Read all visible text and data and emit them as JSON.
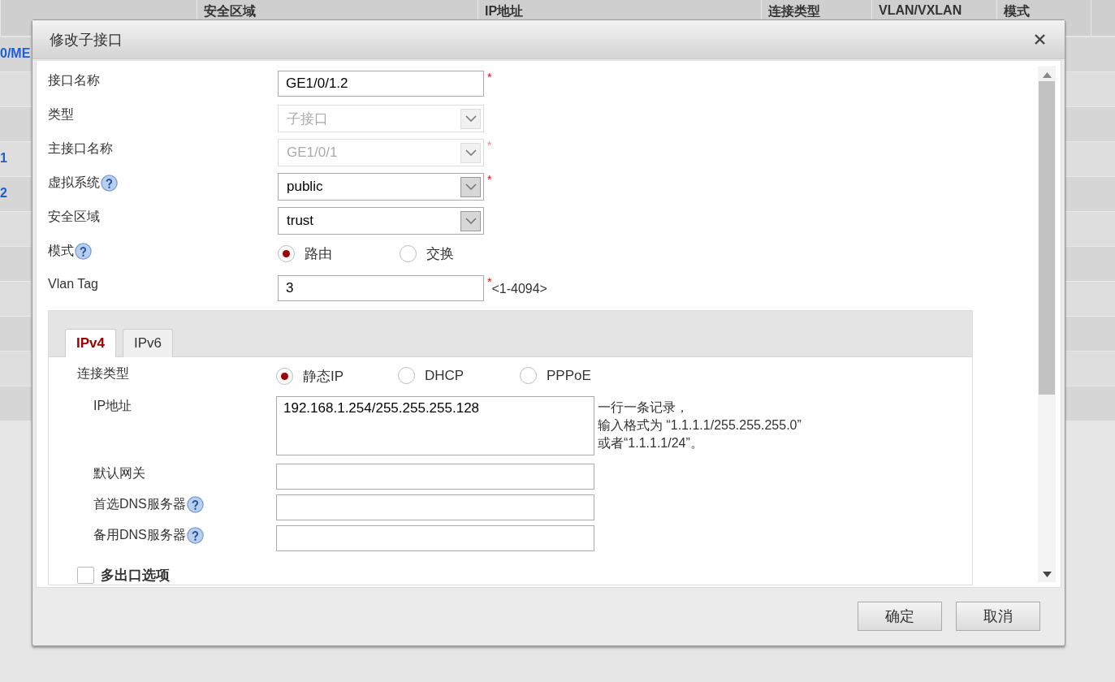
{
  "background_table": {
    "columns": [
      "安全区域",
      "IP地址",
      "连接类型",
      "VLAN/VXLAN",
      "模式"
    ],
    "rows": [
      {
        "interface": "0/ME"
      },
      {},
      {},
      {
        "interface": "1"
      },
      {
        "interface": "2"
      },
      {},
      {},
      {},
      {},
      {},
      {}
    ]
  },
  "dialog": {
    "title": "修改子接口",
    "fields": [
      {
        "kind": "text",
        "label": "接口名称",
        "value": "GE1/0/1.2",
        "required_mark": "*"
      },
      {
        "kind": "select",
        "label": "类型",
        "value": "子接口",
        "disabled": true
      },
      {
        "kind": "select",
        "label": "主接口名称",
        "value": "GE1/0/1",
        "disabled": true,
        "required_mark": "*"
      },
      {
        "kind": "select",
        "label": "虚拟系统",
        "help": true,
        "value": "public",
        "disabled": false,
        "required_mark": "*"
      },
      {
        "kind": "select",
        "label": "安全区域",
        "value": "trust",
        "disabled": false
      },
      {
        "kind": "radio",
        "label": "模式",
        "help": true,
        "options": [
          {
            "label": "路由",
            "selected": true
          },
          {
            "label": "交换",
            "selected": false
          }
        ]
      },
      {
        "kind": "text",
        "label": "Vlan Tag",
        "value": "3",
        "required_mark": "*",
        "suffix": "<1-4094>"
      }
    ],
    "tabs": [
      {
        "label": "IPv4",
        "selected": true
      },
      {
        "label": "IPv6",
        "selected": false
      }
    ],
    "connection_type": {
      "label": "连接类型",
      "options": [
        {
          "label": "静态IP",
          "selected": true
        },
        {
          "label": "DHCP",
          "selected": false
        },
        {
          "label": "PPPoE",
          "selected": false
        }
      ]
    },
    "ip_address": {
      "label": "IP地址",
      "value": "192.168.1.254/255.255.255.128",
      "hint": [
        "一行一条记录，",
        "输入格式为 “1.1.1.1/255.255.255.0”",
        "或者“1.1.1.1/24”。"
      ]
    },
    "ip_fields": [
      {
        "label": "默认网关",
        "help": false
      },
      {
        "label": "首选DNS服务器",
        "help": true
      },
      {
        "label": "备用DNS服务器",
        "help": true
      }
    ],
    "multi_exit": {
      "label": "多出口选项",
      "checked": false
    },
    "buttons": [
      "确定",
      "取消"
    ]
  }
}
